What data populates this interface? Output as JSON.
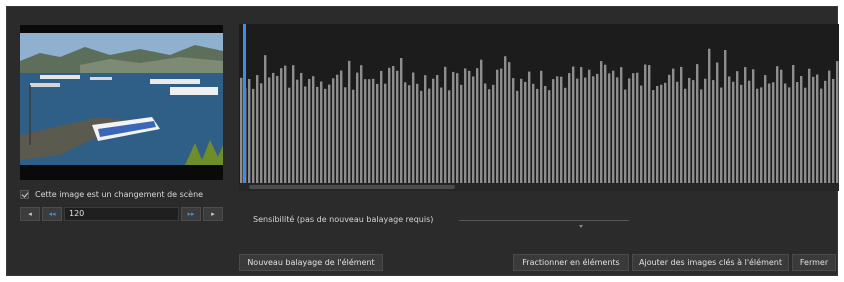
{
  "scene_change_checkbox": {
    "label": "Cette image est un changement de scène",
    "checked": true
  },
  "navigation": {
    "prev_label": "◂",
    "rewind_label": "◂◂",
    "frame_value": "120",
    "forward_label": "▸▸",
    "next_label": "▸"
  },
  "sensitivity": {
    "label": "Sensibilité (pas de nouveau balayage requis)",
    "value": 0.72
  },
  "buttons": {
    "rescan": "Nouveau balayage de l'élément",
    "split": "Fractionner en éléments",
    "add_keyframes": "Ajouter des images clés à l'élément",
    "close": "Fermer"
  },
  "colors": {
    "accent": "#3b8fe4",
    "bar": "#8e8e8e",
    "panel": "#2b2b2b"
  },
  "icons": [
    "checkbox-check-icon",
    "prev-frame-icon",
    "rewind-icon",
    "fast-forward-icon",
    "next-frame-icon"
  ]
}
